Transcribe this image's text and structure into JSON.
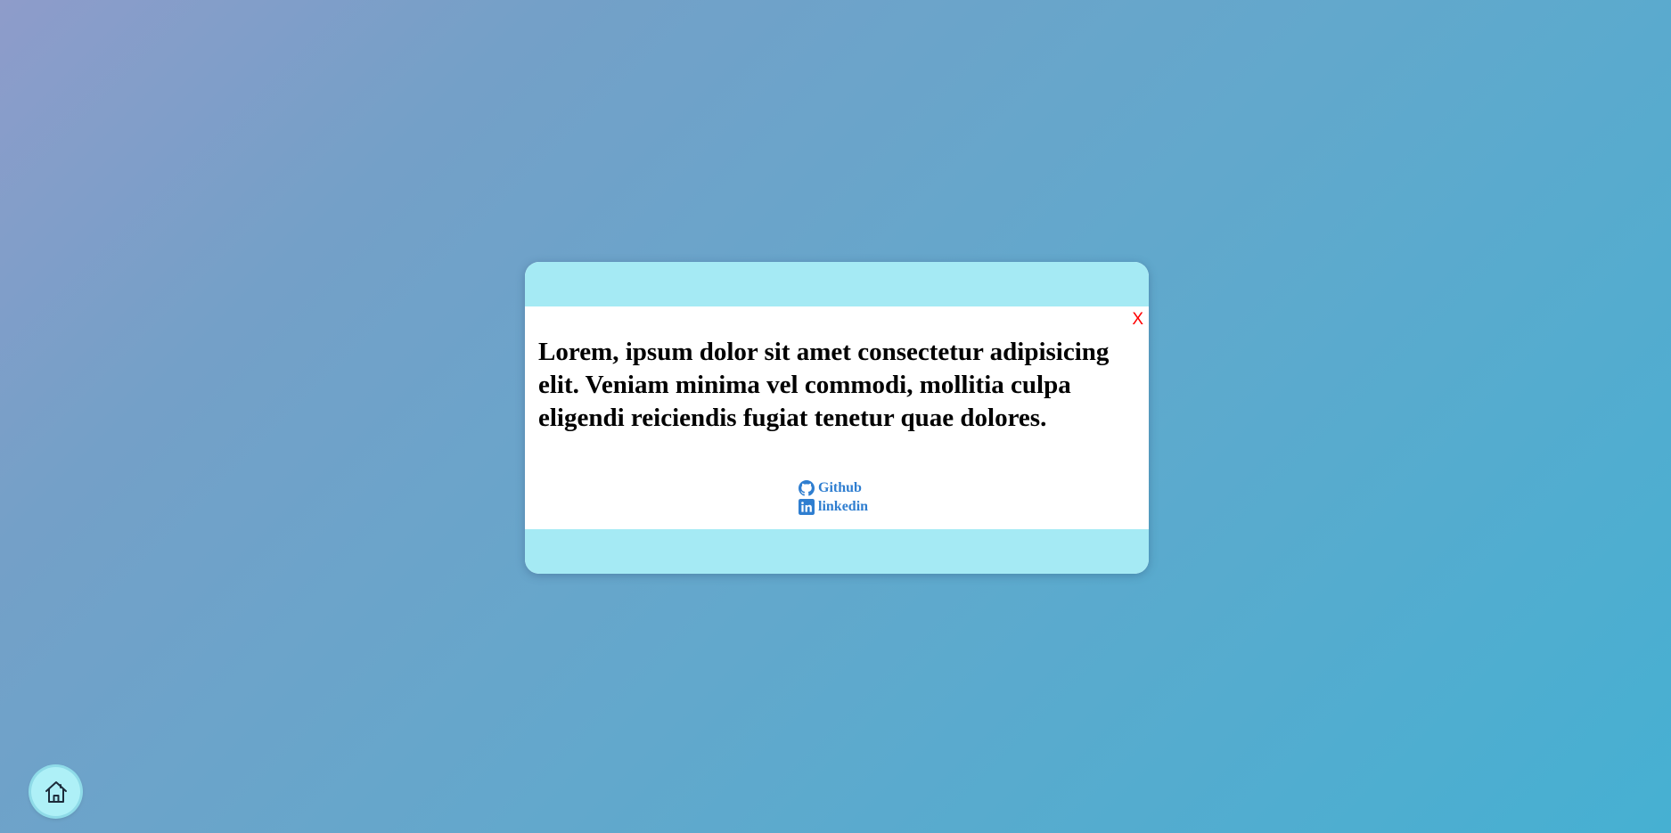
{
  "modal": {
    "close_label": "X",
    "message": "Lorem, ipsum dolor sit amet consectetur adipisicing elit. Veniam minima vel commodi, mollitia culpa eligendi reiciendis fugiat tenetur quae dolores.",
    "links": [
      {
        "label": "Github",
        "icon": "github-icon"
      },
      {
        "label": "linkedin",
        "icon": "linkedin-icon"
      }
    ]
  },
  "home_button": {
    "icon": "home-icon"
  },
  "colors": {
    "modal_band": "#a5eaf4",
    "close": "#ff0000",
    "link": "#2f7ed0",
    "home_button": "#aef0f7"
  }
}
